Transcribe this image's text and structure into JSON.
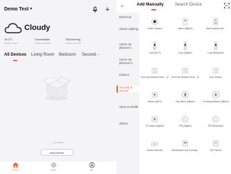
{
  "home": {
    "name": "Demo Test",
    "weather": {
      "condition": "Cloudy",
      "stats": [
        {
          "value": "15.2°C",
          "label": "Outdoor Temp."
        },
        {
          "value": "Comfortable",
          "label": "Outdoor Humidity"
        },
        {
          "value": "768.0mmHg",
          "label": "Outdoor Air Pres..."
        }
      ]
    },
    "tabs": [
      "All Devices",
      "Living Room",
      "Bedroom",
      "Second···"
    ],
    "empty_text": "No device",
    "add_device_label": "Add Device",
    "nav": [
      "Home",
      "Smart",
      "Me"
    ]
  },
  "add_device": {
    "tabs": [
      "Add Manually",
      "Search Device"
    ],
    "categories": [
      "Electrical",
      "Smart Lighting",
      "Home Ap-pliances I",
      "Home Ap-pliances II",
      "Kitchen",
      "Security & Sensor",
      "Sport & Health",
      "Others"
    ],
    "active_category": "Security & Sensor",
    "devices": [
      {
        "name": "Smart Camera",
        "icon": "camera-icon"
      },
      {
        "name": "Alarm (Zigbee)",
        "icon": "alarm-icon"
      },
      {
        "name": "Alarm system (Wi...",
        "icon": "alarm-system-icon"
      },
      {
        "name": "Lock (Wi-Fi)",
        "icon": "lock-icon"
      },
      {
        "name": "Lock (Zigbee)",
        "icon": "lock-icon"
      },
      {
        "name": "Lock (Bluetooth)",
        "icon": "lock-icon"
      },
      {
        "name": "Door and Window Sens... (Zigbee)",
        "icon": "door-sensor-icon"
      },
      {
        "name": "Door And Window Sens... (Wi-Fi)",
        "icon": "door-sensor-icon"
      },
      {
        "name": "Door Sensor",
        "icon": "door-sensor-icon"
      },
      {
        "name": "Sensor (Wi-Fi)",
        "icon": "sensor-icon"
      },
      {
        "name": "Gas Alarm (Zigbee)",
        "icon": "gas-alarm-icon"
      },
      {
        "name": "Flooding detector (Zigbee)",
        "icon": "flood-detector-icon"
      },
      {
        "name": "CO alarm (Zigbee)",
        "icon": "co-alarm-icon"
      },
      {
        "name": "PIR (Zigbee)",
        "icon": "pir-icon"
      },
      {
        "name": "PIR (Bluetooth)",
        "icon": "pir-icon"
      },
      {
        "name": "Smoke Detector",
        "icon": "smoke-detector-icon"
      },
      {
        "name": "Temperature and Humidity...",
        "icon": "thermometer-icon"
      },
      {
        "name": "T&H Sensor",
        "icon": "th-sensor-icon"
      }
    ]
  },
  "colors": {
    "accent": "#ff5a28",
    "background": "#f4f4f6"
  }
}
